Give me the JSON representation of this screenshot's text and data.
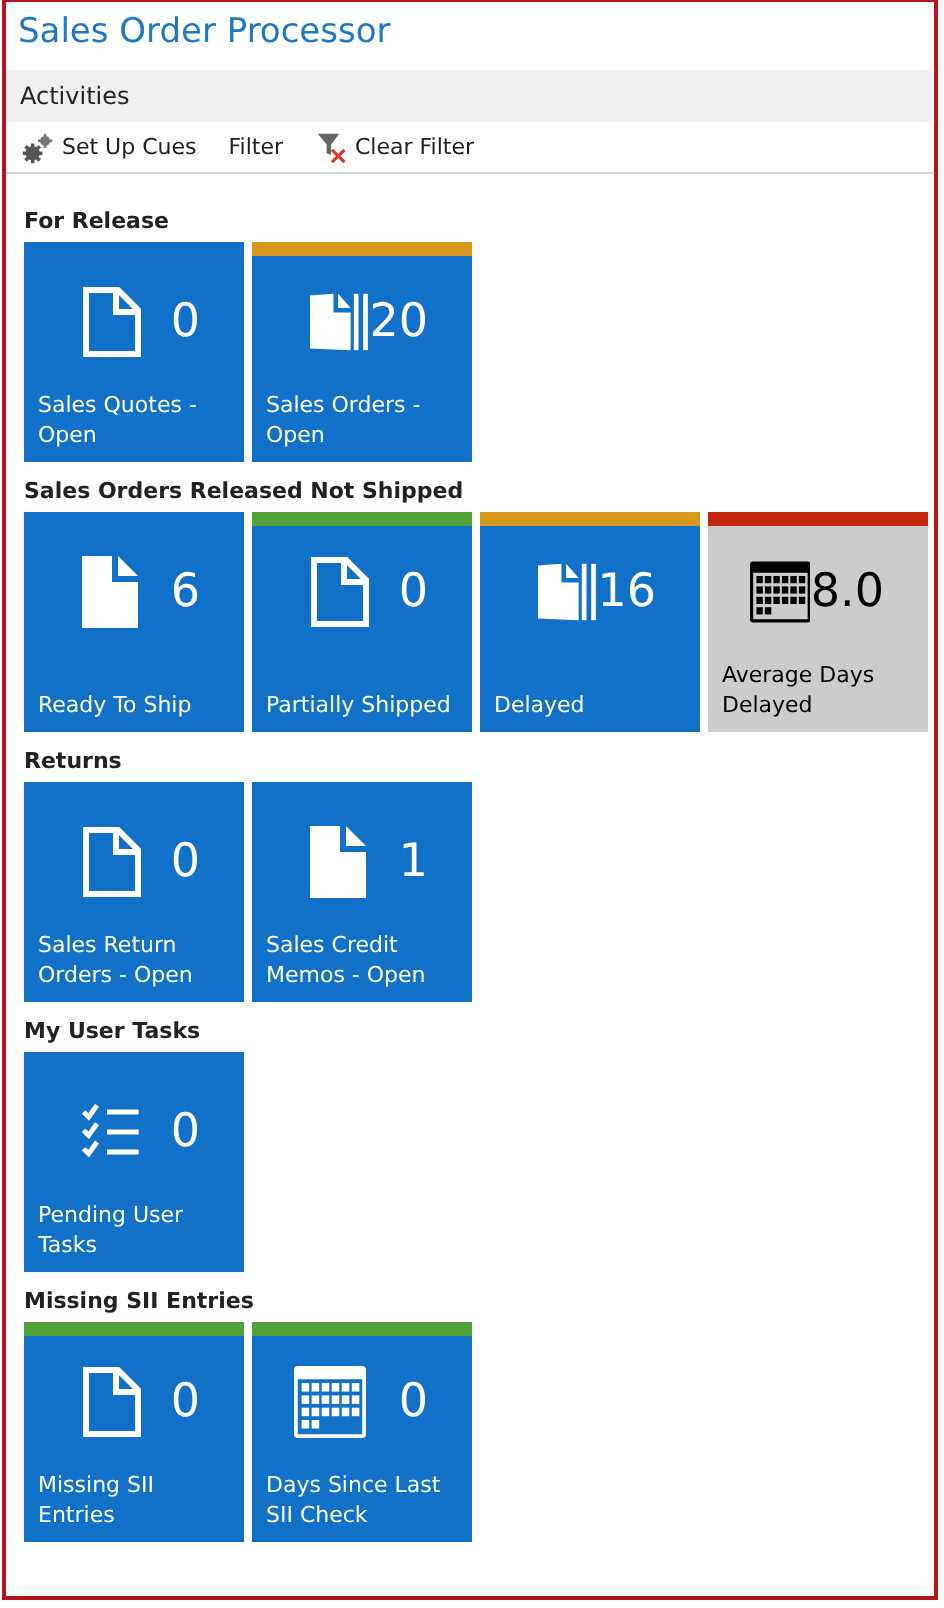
{
  "window": {
    "title": "Sales Order Processor"
  },
  "part": {
    "title": "Activities"
  },
  "toolbar": [
    {
      "label": "Set Up Cues",
      "kind": "gears"
    },
    {
      "label": "Filter",
      "kind": "none"
    },
    {
      "label": "Clear Filter",
      "kind": "clear-filter"
    }
  ],
  "groups": [
    {
      "title": "For Release",
      "tiles": [
        {
          "label": "Sales Quotes - Open",
          "value": "0",
          "kind": "doc-outline",
          "inverted": false
        },
        {
          "label": "Sales Orders - Open",
          "value": "20",
          "kind": "docs",
          "inverted": false,
          "color": "#d8981e"
        }
      ]
    },
    {
      "title": "Sales Orders Released Not Shipped",
      "tiles": [
        {
          "label": "Ready To Ship",
          "value": "6",
          "kind": "doc-filled",
          "inverted": false
        },
        {
          "label": "Partially Shipped",
          "value": "0",
          "kind": "doc-outline",
          "inverted": false,
          "color": "#52a13a"
        },
        {
          "label": "Delayed",
          "value": "16",
          "kind": "docs",
          "inverted": false,
          "color": "#d8981e"
        },
        {
          "label": "Average Days Delayed",
          "value": "8.0",
          "kind": "calendar",
          "inverted": true,
          "color": "#c4260f"
        }
      ]
    },
    {
      "title": "Returns",
      "tiles": [
        {
          "label": "Sales Return Orders - Open",
          "value": "0",
          "kind": "doc-outline",
          "inverted": false
        },
        {
          "label": "Sales Credit Memos - Open",
          "value": "1",
          "kind": "doc-filled",
          "inverted": false
        }
      ]
    },
    {
      "title": "My User Tasks",
      "tiles": [
        {
          "label": "Pending User Tasks",
          "value": "0",
          "kind": "checklist",
          "inverted": false
        }
      ]
    },
    {
      "title": "Missing SII Entries",
      "tiles": [
        {
          "label": "Missing SII Entries",
          "value": "0",
          "kind": "doc-outline",
          "inverted": false,
          "color": "#52a13a"
        },
        {
          "label": "Days Since Last SII Check",
          "value": "0",
          "kind": "calendar",
          "inverted": false,
          "color": "#52a13a"
        }
      ]
    }
  ]
}
